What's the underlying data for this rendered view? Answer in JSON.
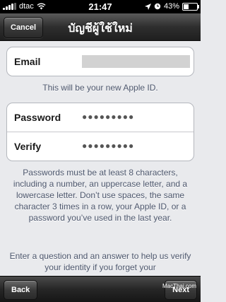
{
  "status_bar": {
    "carrier": "dtac",
    "time": "21:47",
    "battery": "43%",
    "battery_level": 0.43
  },
  "nav": {
    "title": "บัญชีผู้ใช้ใหม่",
    "cancel_label": "Cancel"
  },
  "form": {
    "email_label": "Email",
    "email_note": "This will be your new Apple ID.",
    "password_label": "Password",
    "password_value": "●●●●●●●●●",
    "verify_label": "Verify",
    "verify_value": "●●●●●●●●●",
    "password_rules": "Passwords must be at least 8 characters, including a number, an uppercase letter, and a lowercase letter. Don’t use spaces, the same character 3 times in a row, your Apple ID, or a password you’ve used in the last year.",
    "security_note": "Enter a question and an answer to help us verify your identity if you forget your"
  },
  "toolbar": {
    "back_label": "Back",
    "next_label": "Next"
  },
  "watermark": "MacThai.com"
}
